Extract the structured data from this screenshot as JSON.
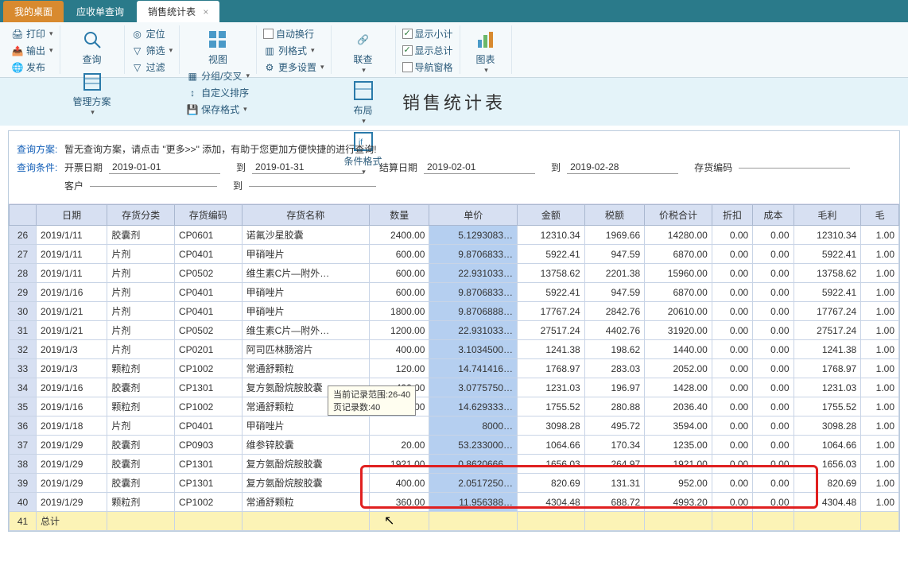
{
  "tabs": {
    "desktop": "我的桌面",
    "receivable": "应收单查询",
    "sales": "销售统计表"
  },
  "ribbon": {
    "print": "打印",
    "export": "输出",
    "publish": "发布",
    "query": "查询",
    "scheme": "管理方案",
    "locate": "定位",
    "filter": "筛选",
    "clearfilter": "过滤",
    "view": "视图",
    "group": "分组/交叉",
    "custorder": "自定义排序",
    "saveformat": "保存格式",
    "autowrap": "自动换行",
    "colformat": "列格式",
    "more": "更多设置",
    "link": "联查",
    "layout": "布局",
    "condfmt": "条件格式",
    "subtotal": "显示小计",
    "total": "显示总计",
    "navpane": "导航窗格",
    "chart": "图表"
  },
  "title": "销售统计表",
  "query": {
    "scheme_label": "查询方案:",
    "scheme_text": "暂无查询方案，请点击 \"更多>>\" 添加，有助于您更加方便快捷的进行查询!",
    "cond_label": "查询条件:",
    "billdate": "开票日期",
    "billdate_from": "2019-01-01",
    "billdate_to": "2019-01-31",
    "settledate": "结算日期",
    "settledate_from": "2019-02-01",
    "settledate_to": "2019-02-28",
    "to": "到",
    "stockcode": "存货编码",
    "customer": "客户"
  },
  "columns": [
    "日期",
    "存货分类",
    "存货编码",
    "存货名称",
    "数量",
    "单价",
    "金额",
    "税额",
    "价税合计",
    "折扣",
    "成本",
    "毛利",
    "毛"
  ],
  "rows": [
    {
      "n": 26,
      "date": "2019/1/11",
      "cat": "胶囊剂",
      "code": "CP0601",
      "name": "诺氟沙星胶囊",
      "qty": "2400.00",
      "price": "5.1293083…",
      "amt": "12310.34",
      "tax": "1969.66",
      "tot": "14280.00",
      "disc": "0.00",
      "cost": "0.00",
      "gp": "12310.34",
      "r": "1.00"
    },
    {
      "n": 27,
      "date": "2019/1/11",
      "cat": "片剂",
      "code": "CP0401",
      "name": "甲硝唑片",
      "qty": "600.00",
      "price": "9.8706833…",
      "amt": "5922.41",
      "tax": "947.59",
      "tot": "6870.00",
      "disc": "0.00",
      "cost": "0.00",
      "gp": "5922.41",
      "r": "1.00"
    },
    {
      "n": 28,
      "date": "2019/1/11",
      "cat": "片剂",
      "code": "CP0502",
      "name": "维生素C片—附外…",
      "qty": "600.00",
      "price": "22.931033…",
      "amt": "13758.62",
      "tax": "2201.38",
      "tot": "15960.00",
      "disc": "0.00",
      "cost": "0.00",
      "gp": "13758.62",
      "r": "1.00"
    },
    {
      "n": 29,
      "date": "2019/1/16",
      "cat": "片剂",
      "code": "CP0401",
      "name": "甲硝唑片",
      "qty": "600.00",
      "price": "9.8706833…",
      "amt": "5922.41",
      "tax": "947.59",
      "tot": "6870.00",
      "disc": "0.00",
      "cost": "0.00",
      "gp": "5922.41",
      "r": "1.00"
    },
    {
      "n": 30,
      "date": "2019/1/21",
      "cat": "片剂",
      "code": "CP0401",
      "name": "甲硝唑片",
      "qty": "1800.00",
      "price": "9.8706888…",
      "amt": "17767.24",
      "tax": "2842.76",
      "tot": "20610.00",
      "disc": "0.00",
      "cost": "0.00",
      "gp": "17767.24",
      "r": "1.00"
    },
    {
      "n": 31,
      "date": "2019/1/21",
      "cat": "片剂",
      "code": "CP0502",
      "name": "维生素C片—附外…",
      "qty": "1200.00",
      "price": "22.931033…",
      "amt": "27517.24",
      "tax": "4402.76",
      "tot": "31920.00",
      "disc": "0.00",
      "cost": "0.00",
      "gp": "27517.24",
      "r": "1.00"
    },
    {
      "n": 32,
      "date": "2019/1/3",
      "cat": "片剂",
      "code": "CP0201",
      "name": "阿司匹林肠溶片",
      "qty": "400.00",
      "price": "3.1034500…",
      "amt": "1241.38",
      "tax": "198.62",
      "tot": "1440.00",
      "disc": "0.00",
      "cost": "0.00",
      "gp": "1241.38",
      "r": "1.00"
    },
    {
      "n": 33,
      "date": "2019/1/3",
      "cat": "颗粒剂",
      "code": "CP1002",
      "name": "常通舒颗粒",
      "qty": "120.00",
      "price": "14.741416…",
      "amt": "1768.97",
      "tax": "283.03",
      "tot": "2052.00",
      "disc": "0.00",
      "cost": "0.00",
      "gp": "1768.97",
      "r": "1.00"
    },
    {
      "n": 34,
      "date": "2019/1/16",
      "cat": "胶囊剂",
      "code": "CP1301",
      "name": "复方氨酚烷胺胶囊",
      "qty": "400.00",
      "price": "3.0775750…",
      "amt": "1231.03",
      "tax": "196.97",
      "tot": "1428.00",
      "disc": "0.00",
      "cost": "0.00",
      "gp": "1231.03",
      "r": "1.00"
    },
    {
      "n": 35,
      "date": "2019/1/16",
      "cat": "颗粒剂",
      "code": "CP1002",
      "name": "常通舒颗粒",
      "qty": "120.00",
      "price": "14.629333…",
      "amt": "1755.52",
      "tax": "280.88",
      "tot": "2036.40",
      "disc": "0.00",
      "cost": "0.00",
      "gp": "1755.52",
      "r": "1.00"
    },
    {
      "n": 36,
      "date": "2019/1/18",
      "cat": "片剂",
      "code": "CP0401",
      "name": "甲硝唑片",
      "qty": "",
      "price": "8000…",
      "amt": "3098.28",
      "tax": "495.72",
      "tot": "3594.00",
      "disc": "0.00",
      "cost": "0.00",
      "gp": "3098.28",
      "r": "1.00"
    },
    {
      "n": 37,
      "date": "2019/1/29",
      "cat": "胶囊剂",
      "code": "CP0903",
      "name": "维参锌胶囊",
      "qty": "20.00",
      "price": "53.233000…",
      "amt": "1064.66",
      "tax": "170.34",
      "tot": "1235.00",
      "disc": "0.00",
      "cost": "0.00",
      "gp": "1064.66",
      "r": "1.00"
    },
    {
      "n": 38,
      "date": "2019/1/29",
      "cat": "胶囊剂",
      "code": "CP1301",
      "name": "复方氨酚烷胺胶囊",
      "qty": "1921.00",
      "price": "0.8620666…",
      "amt": "1656.03",
      "tax": "264.97",
      "tot": "1921.00",
      "disc": "0.00",
      "cost": "0.00",
      "gp": "1656.03",
      "r": "1.00"
    },
    {
      "n": 39,
      "date": "2019/1/29",
      "cat": "胶囊剂",
      "code": "CP1301",
      "name": "复方氨酚烷胺胶囊",
      "qty": "400.00",
      "price": "2.0517250…",
      "amt": "820.69",
      "tax": "131.31",
      "tot": "952.00",
      "disc": "0.00",
      "cost": "0.00",
      "gp": "820.69",
      "r": "1.00"
    },
    {
      "n": 40,
      "date": "2019/1/29",
      "cat": "颗粒剂",
      "code": "CP1002",
      "name": "常通舒颗粒",
      "qty": "360.00",
      "price": "11.956388…",
      "amt": "4304.48",
      "tax": "688.72",
      "tot": "4993.20",
      "disc": "0.00",
      "cost": "0.00",
      "gp": "4304.48",
      "r": "1.00"
    }
  ],
  "total_label": "总计",
  "total_rn": "41",
  "tooltip": {
    "line1": "当前记录范围:26-40",
    "line2": "页记录数:40"
  }
}
